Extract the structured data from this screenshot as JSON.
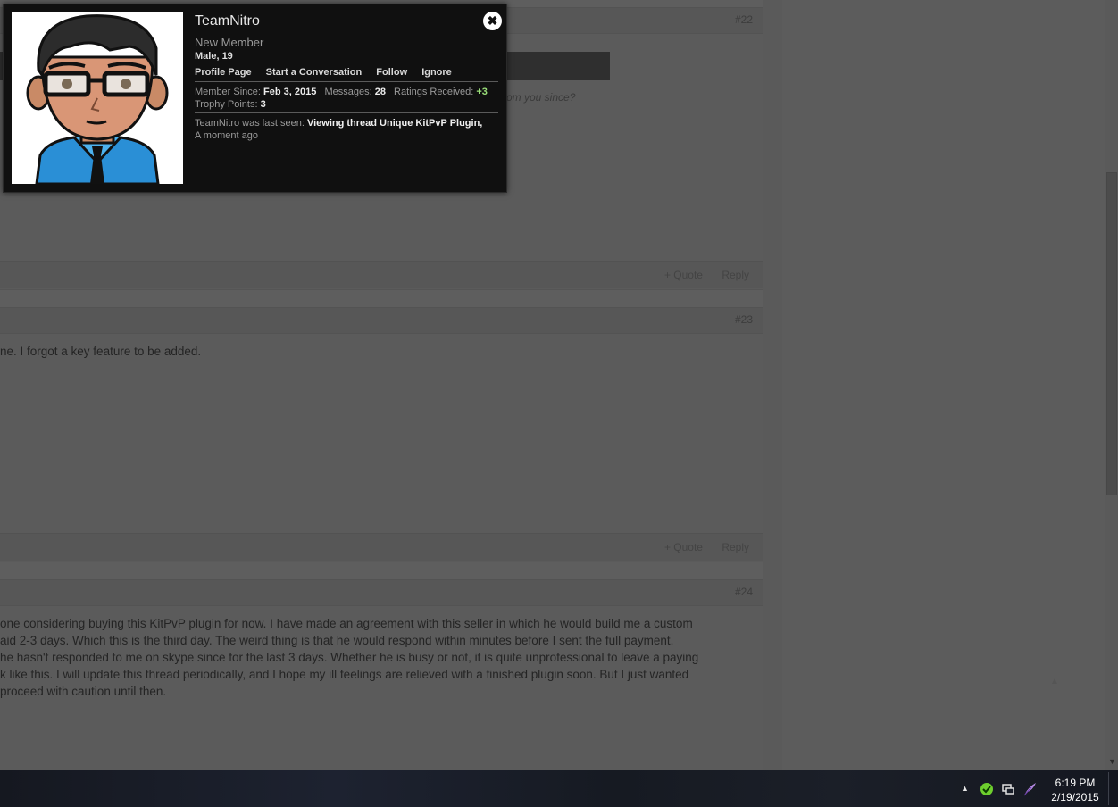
{
  "posts": [
    {
      "number": "#22",
      "lines": [],
      "quote_tail": "om you since?",
      "faint": "",
      "actions": {
        "quote": "+ Quote",
        "reply": "Reply"
      }
    },
    {
      "number": "#23",
      "lines": [
        "ne. I forgot a key feature to be added."
      ],
      "actions": {
        "quote": "+ Quote",
        "reply": "Reply"
      }
    },
    {
      "number": "#24",
      "lines": [
        "one considering buying this KitPvP plugin for now. I have made an agreement with this seller in which he would build me a custom",
        "aid 2-3 days. Which this is the third day. The weird thing is that he would respond within minutes before I sent the full payment.",
        "he hasn't responded to me on skype since for the last 3 days. Whether he is busy or not, it is quite unprofessional to leave a paying",
        "k like this. I will update this thread periodically, and I hope my ill feelings are relieved with a finished plugin soon. But I just wanted",
        "proceed with caution until then."
      ]
    }
  ],
  "popup": {
    "username": "TeamNitro",
    "user_title": "New Member",
    "basic": "Male, 19",
    "links": [
      "Profile Page",
      "Start a Conversation",
      "Follow",
      "Ignore"
    ],
    "stats": {
      "member_since_label": "Member Since:",
      "member_since": "Feb 3, 2015",
      "messages_label": "Messages:",
      "messages": "28",
      "ratings_label": "Ratings Received:",
      "ratings": "+3",
      "trophy_label": "Trophy Points:",
      "trophy": "3"
    },
    "last_seen_prefix": "TeamNitro was last seen:",
    "last_seen_activity": "Viewing thread Unique KitPvP Plugin,",
    "last_seen_time": "A moment ago",
    "close_icon": "close-icon",
    "avatar_icon": "cartoon-avatar"
  },
  "taskbar": {
    "time": "6:19 PM",
    "date": "2/19/2015",
    "tray_icons": [
      "show-hidden-icons-arrow",
      "security-shield-icon",
      "network-icon",
      "feather-app-icon"
    ]
  },
  "colors": {
    "popup_bg": "#101010",
    "positive": "#9be07a",
    "page_dim": "#5e5e5e"
  }
}
